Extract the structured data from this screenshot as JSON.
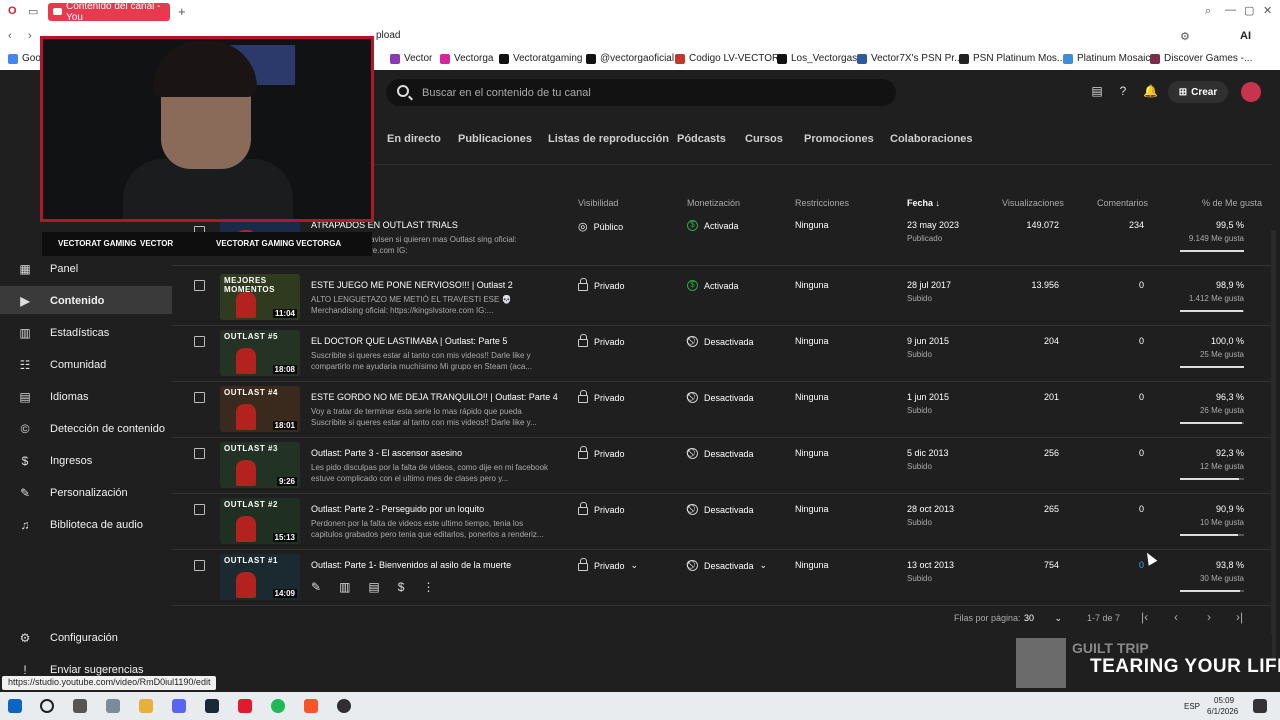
{
  "browser": {
    "tab_title": "Contenido del canal - You",
    "address_fragment": "pload",
    "bookmarks": [
      {
        "label": "Goog",
        "color": "#4285f4"
      },
      {
        "label": "Vector",
        "color": "#8a3ab9"
      },
      {
        "label": "Vectorga",
        "color": "#d6249f"
      },
      {
        "label": "Vectoratgaming",
        "color": "#111111"
      },
      {
        "label": "@vectorgaoficial",
        "color": "#111111"
      },
      {
        "label": "Codigo LV-VECTOR",
        "color": "#c0392b"
      },
      {
        "label": "Los_Vectorgas",
        "color": "#111111"
      },
      {
        "label": "Vector7X's PSN Pr...",
        "color": "#2d5a9e"
      },
      {
        "label": "PSN Platinum Mos...",
        "color": "#222222"
      },
      {
        "label": "Platinum Mosaic",
        "color": "#3b8ed8"
      },
      {
        "label": "Discover Games -...",
        "color": "#7a2c4a"
      }
    ]
  },
  "header": {
    "search_placeholder": "Buscar en el contenido de tu canal",
    "create_label": "Crear"
  },
  "tabs": [
    "En directo",
    "Publicaciones",
    "Listas de reproducción",
    "Pódcasts",
    "Cursos",
    "Promociones",
    "Colaboraciones"
  ],
  "sidebar": {
    "items": [
      {
        "label": "Panel",
        "icon": "dashboard-icon"
      },
      {
        "label": "Contenido",
        "icon": "content-icon",
        "active": true
      },
      {
        "label": "Estadísticas",
        "icon": "analytics-icon"
      },
      {
        "label": "Comunidad",
        "icon": "community-icon"
      },
      {
        "label": "Idiomas",
        "icon": "subtitles-icon"
      },
      {
        "label": "Detección de contenido",
        "icon": "copyright-icon"
      },
      {
        "label": "Ingresos",
        "icon": "earn-icon"
      },
      {
        "label": "Personalización",
        "icon": "customization-icon"
      },
      {
        "label": "Biblioteca de audio",
        "icon": "audio-library-icon"
      }
    ],
    "bottom": [
      {
        "label": "Configuración",
        "icon": "settings-icon"
      },
      {
        "label": "Enviar sugerencias",
        "icon": "feedback-icon"
      }
    ]
  },
  "table": {
    "columns": {
      "visibility": "Visibilidad",
      "monetization": "Monetización",
      "restrictions": "Restricciones",
      "date": "Fecha",
      "views": "Visualizaciones",
      "comments": "Comentarios",
      "likes": "% de Me gusta"
    },
    "rows": [
      {
        "title": "ATRAPADOS EN OUTLAST TRIALS",
        "desc": "sfruten mucho y avisen si quieren mas Outlast\nsing oficial: https://kingslvstore.com IG:",
        "duration": "",
        "brand": "",
        "visibility": "Público",
        "monetization": "Activada",
        "mon_on": true,
        "restrictions": "Ninguna",
        "date": "23 may 2023",
        "date_sub": "Publicado",
        "views": "149.072",
        "comments": "234",
        "likes": "99,5 %",
        "likes_sub": "9.149 Me gusta",
        "like_pct": 99.5,
        "thumb_color": "#1c2a4a"
      },
      {
        "title": "ESTE JUEGO ME PONE NERVIOSO!!! | Outlast 2",
        "desc": "ALTO LENGUETAZO ME METIÓ EL TRAVESTI ESE 💀\nMerchandising oficial: https://kingslvstore.com IG:...",
        "duration": "11:04",
        "brand": "MEJORES MOMENTOS",
        "visibility": "Privado",
        "monetization": "Activada",
        "mon_on": true,
        "restrictions": "Ninguna",
        "date": "28 jul 2017",
        "date_sub": "Subido",
        "views": "13.956",
        "comments": "0",
        "likes": "98,9 %",
        "likes_sub": "1.412 Me gusta",
        "like_pct": 98.9,
        "thumb_color": "#2f3a1f"
      },
      {
        "title": "EL DOCTOR QUE LASTIMABA | Outlast: Parte 5",
        "desc": "Suscribite si queres estar al tanto con mis videos!! Darle like y compartirlo me ayudaria muchísimo Mi grupo en Steam (aca...",
        "duration": "18:08",
        "brand": "OUTLAST #5",
        "visibility": "Privado",
        "monetization": "Desactivada",
        "mon_on": false,
        "restrictions": "Ninguna",
        "date": "9 jun 2015",
        "date_sub": "Subido",
        "views": "204",
        "comments": "0",
        "likes": "100,0 %",
        "likes_sub": "25 Me gusta",
        "like_pct": 100,
        "thumb_color": "#253325"
      },
      {
        "title": "ESTE GORDO NO ME DEJA TRANQUILO!! | Outlast: Parte 4",
        "desc": "Voy a tratar de terminar esta serie lo mas rápido que pueda Suscribite si queres estar al tanto con mis videos!! Darle like y...",
        "duration": "18:01",
        "brand": "OUTLAST #4",
        "visibility": "Privado",
        "monetization": "Desactivada",
        "mon_on": false,
        "restrictions": "Ninguna",
        "date": "1 jun 2015",
        "date_sub": "Subido",
        "views": "201",
        "comments": "0",
        "likes": "96,3 %",
        "likes_sub": "26 Me gusta",
        "like_pct": 96.3,
        "thumb_color": "#3a2a1e"
      },
      {
        "title": "Outlast: Parte 3 - El ascensor asesino",
        "desc": "Les pido disculpas por la falta de videos, como dije en mi facebook estuve complicado con el ultimo mes de clases pero y...",
        "duration": "9:26",
        "brand": "OUTLAST #3",
        "visibility": "Privado",
        "monetization": "Desactivada",
        "mon_on": false,
        "restrictions": "Ninguna",
        "date": "5 dic 2013",
        "date_sub": "Subido",
        "views": "256",
        "comments": "0",
        "likes": "92,3 %",
        "likes_sub": "12 Me gusta",
        "like_pct": 92.3,
        "thumb_color": "#223326"
      },
      {
        "title": "Outlast: Parte 2 - Perseguido por un loquito",
        "desc": "Perdonen por la falta de videos este ultimo tiempo, tenia los capitulos grabados pero tenia que editarlos, ponerlos a renderiz...",
        "duration": "15:13",
        "brand": "OUTLAST #2",
        "visibility": "Privado",
        "monetization": "Desactivada",
        "mon_on": false,
        "restrictions": "Ninguna",
        "date": "28 oct 2013",
        "date_sub": "Subido",
        "views": "265",
        "comments": "0",
        "likes": "90,9 %",
        "likes_sub": "10 Me gusta",
        "like_pct": 90.9,
        "thumb_color": "#1f2f22"
      },
      {
        "title": "Outlast: Parte 1- Bienvenidos al asilo de la muerte",
        "desc": "",
        "duration": "14:09",
        "brand": "OUTLAST #1",
        "visibility": "Privado",
        "monetization": "Desactivada",
        "mon_on": false,
        "restrictions": "Ninguna",
        "date": "13 oct 2013",
        "date_sub": "Subido",
        "views": "754",
        "comments": "0",
        "likes": "93,8 %",
        "likes_sub": "30 Me gusta",
        "like_pct": 93.8,
        "thumb_color": "#1a2a30",
        "hovered": true
      }
    ]
  },
  "pagination": {
    "rows_label": "Filas por página:",
    "rows_value": "30",
    "range": "1-7 de 7"
  },
  "overlay": {
    "socials": [
      "VECTORAT GAMING",
      "VECTOR",
      "VECTORAT GAMING",
      "VECTORGA"
    ],
    "music_artist": "GUILT TRIP",
    "music_title": "TEARING YOUR LIFI",
    "status_url": "https://studio.youtube.com/video/RmD0iul1190/edit"
  },
  "taskbar": {
    "time": "05:09",
    "date": "6/1/2026",
    "lang": "ESP"
  },
  "colors": {
    "accent_red": "#e83a4f",
    "active_green": "#2ba640",
    "webcam_border": "#b3162a"
  }
}
